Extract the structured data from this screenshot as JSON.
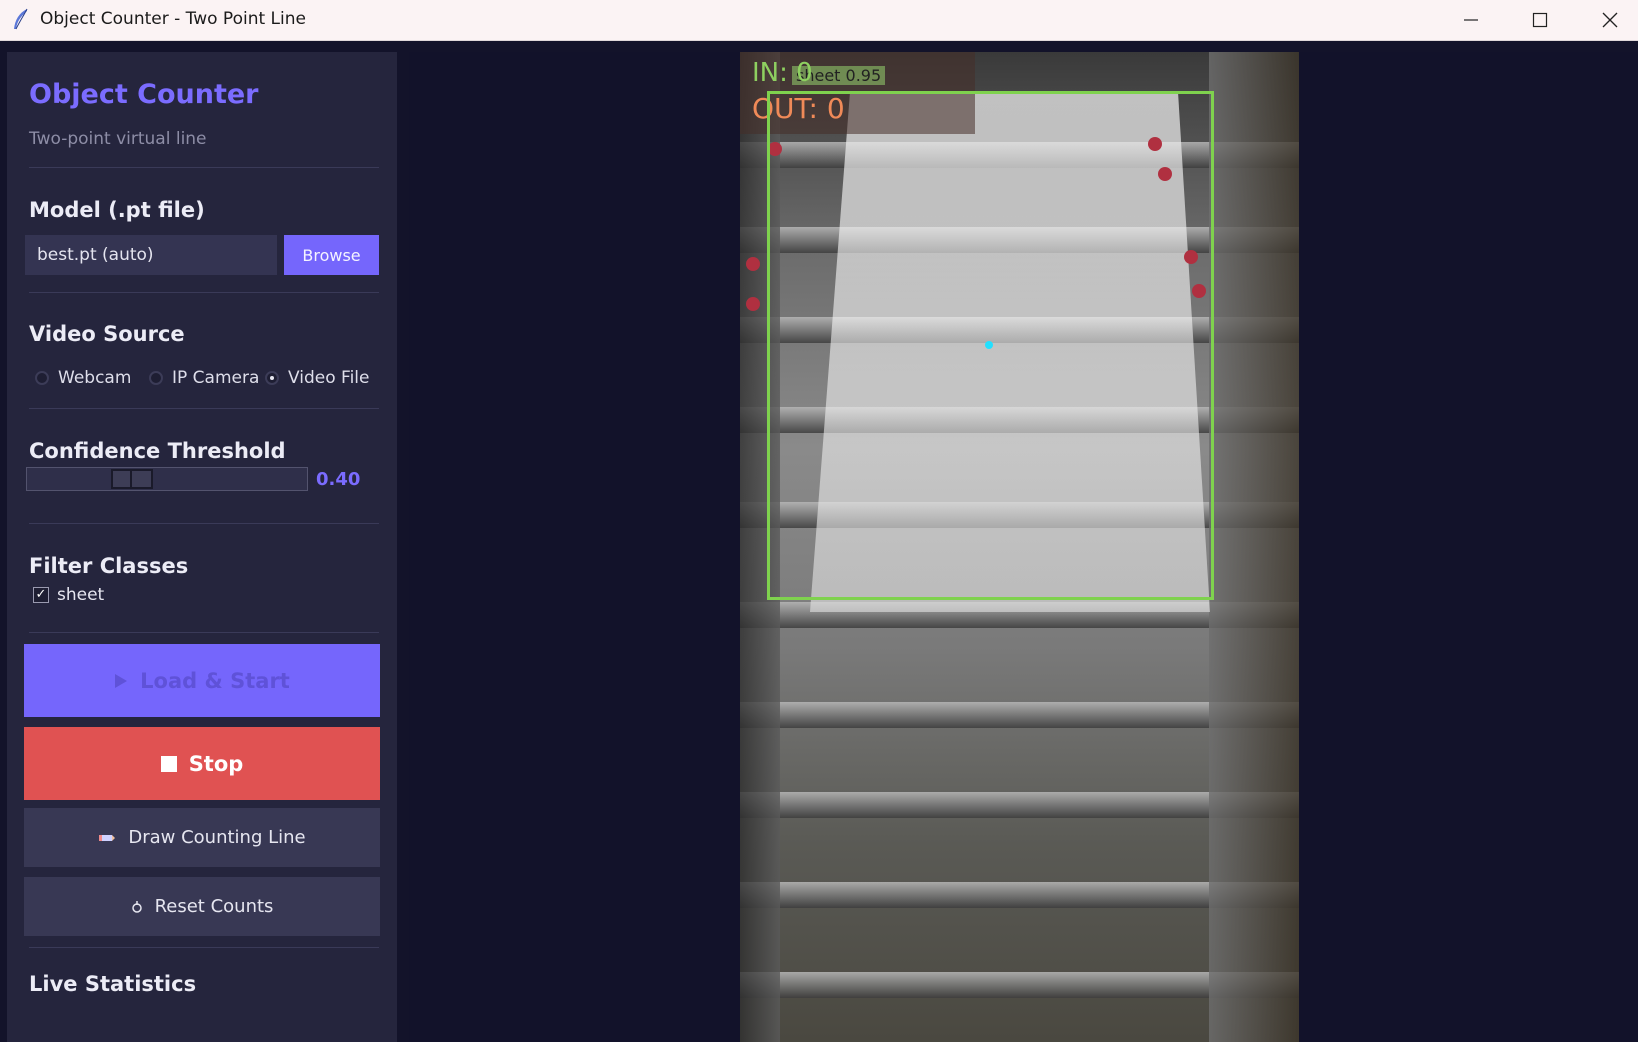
{
  "window": {
    "title": "Object Counter - Two Point Line",
    "icons": {
      "app": "feather-icon",
      "minimize": "minimize-icon",
      "maximize": "maximize-icon",
      "close": "close-icon"
    }
  },
  "sidebar": {
    "app_title": "Object Counter",
    "app_subtitle": "Two-point virtual line",
    "model": {
      "section_title": "Model (.pt file)",
      "input_value": "best.pt (auto)",
      "browse_label": "Browse"
    },
    "video_source": {
      "section_title": "Video Source",
      "options": [
        {
          "label": "Webcam",
          "selected": false
        },
        {
          "label": "IP Camera",
          "selected": false
        },
        {
          "label": "Video File",
          "selected": true
        }
      ]
    },
    "confidence": {
      "section_title": "Confidence Threshold",
      "value": 0.4,
      "value_label": "0.40"
    },
    "filter_classes": {
      "section_title": "Filter Classes",
      "classes": [
        {
          "label": "sheet",
          "checked": true
        }
      ]
    },
    "buttons": {
      "start": {
        "label": "Load & Start",
        "icon": "play-icon",
        "color": "#7566fc"
      },
      "stop": {
        "label": "Stop",
        "icon": "stop-icon",
        "color": "#e05252"
      },
      "draw_line": {
        "label": "Draw Counting Line",
        "icon": "pencil-icon"
      },
      "reset": {
        "label": "Reset Counts",
        "icon": "refresh-icon"
      }
    },
    "live_statistics": {
      "section_title": "Live Statistics"
    }
  },
  "video": {
    "in_label": "IN:",
    "in_count": "0",
    "out_label": "OUT:",
    "out_count": "0",
    "detection_label": "sheet 0.95",
    "box_color": "#7fd24e"
  }
}
